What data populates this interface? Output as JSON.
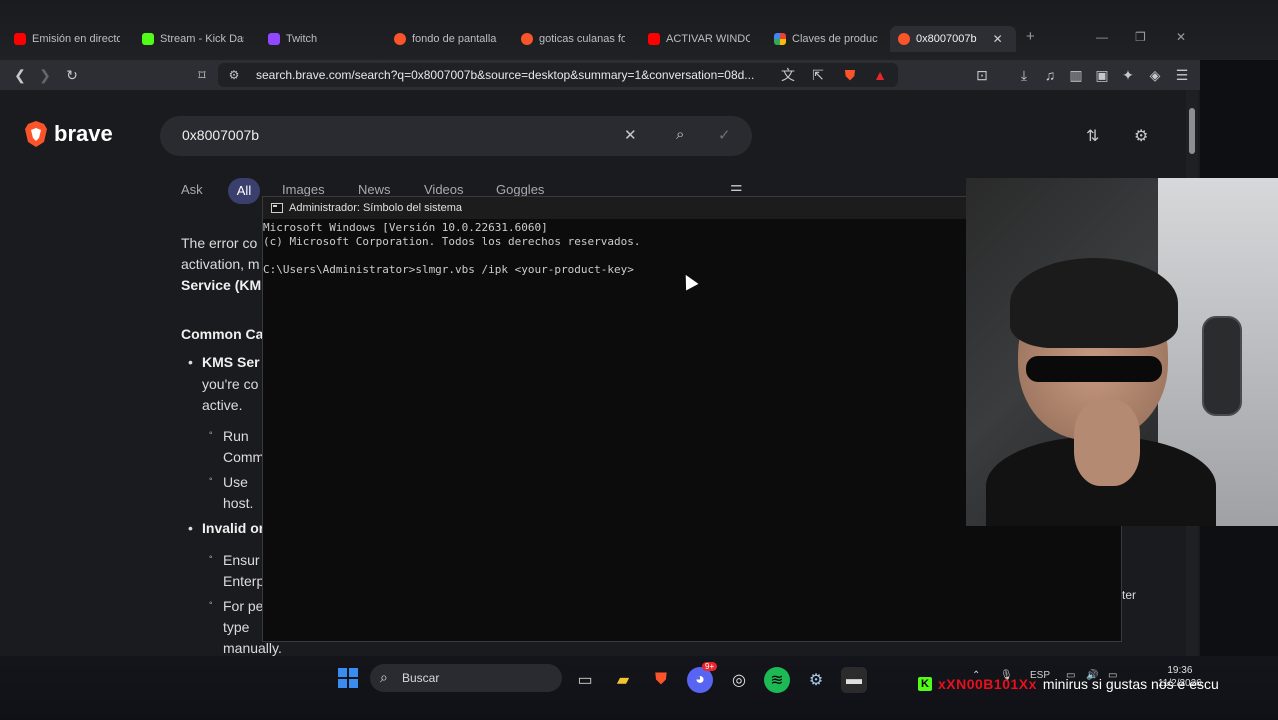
{
  "browser": {
    "tabs": [
      {
        "label": "Emisión en directo",
        "favicon_color": "#ff0000"
      },
      {
        "label": "Stream - Kick Das",
        "favicon_color": "#53fc18"
      },
      {
        "label": "Twitch",
        "favicon_color": "#9146ff"
      },
      {
        "label": "fondo de pantalla",
        "favicon_color": "#fb542b"
      },
      {
        "label": "goticas culanas fo",
        "favicon_color": "#fb542b"
      },
      {
        "label": "ACTIVAR WINDOWS",
        "favicon_color": "#ff0000"
      },
      {
        "label": "Claves de producto",
        "favicon_color": "#4285f4"
      },
      {
        "label": "0x8007007b",
        "favicon_color": "#fb542b",
        "active": true
      }
    ],
    "new_tab": "+",
    "url": "search.brave.com/search?q=0x8007007b&source=desktop&summary=1&conversation=08d..."
  },
  "page": {
    "logo_text": "brave",
    "search_query": "0x8007007b",
    "nav_tabs": [
      "Ask",
      "All",
      "Images",
      "News",
      "Videos",
      "Goggles"
    ],
    "left_text": [
      "The error co",
      "activation, m",
      "Service (KM",
      "Common Ca",
      "KMS Ser",
      "you're co",
      "active.",
      "Run",
      "Comm",
      "Use",
      "host.",
      "Invalid or",
      "Ensur",
      "Enterp",
      "For pe",
      "type",
      "manually."
    ],
    "right_fragment": "ter"
  },
  "terminal": {
    "title": "Administrador: Símbolo del sistema",
    "lines": [
      "Microsoft Windows [Versión 10.0.22631.6060]",
      "(c) Microsoft Corporation. Todos los derechos reservados.",
      "",
      "C:\\Users\\Administrator>slmgr.vbs /ipk <your-product-key>"
    ]
  },
  "taskbar": {
    "search_placeholder": "Buscar",
    "language": "ESP",
    "time": "19:36",
    "date": "11/2/2026",
    "discord_badge": "9+"
  },
  "chat": {
    "username": "xXN00B101Xx",
    "message": "minirus si gustas nos e escu"
  },
  "colors": {
    "brave_orange": "#fb542b",
    "active_tab_pill": "#3b3f6e",
    "chat_username": "#e8101e"
  }
}
